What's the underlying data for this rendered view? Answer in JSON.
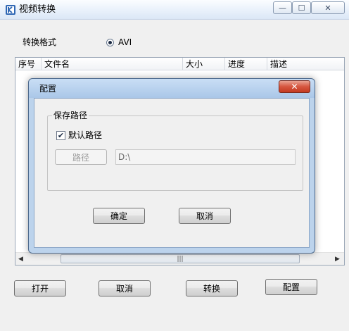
{
  "window": {
    "title": "视频转换",
    "controls": {
      "minimize": "—",
      "maximize": "☐",
      "close": "✕"
    }
  },
  "main": {
    "format_label": "转换格式",
    "format_option": "AVI",
    "columns": [
      "序号",
      "文件名",
      "大小",
      "进度",
      "描述"
    ],
    "buttons": {
      "open": "打开",
      "cancel": "取消",
      "convert": "转换",
      "config": "配置"
    }
  },
  "dialog": {
    "title": "配置",
    "close": "✕",
    "group_title": "保存路径",
    "default_path_label": "默认路径",
    "default_path_checked": true,
    "path_button": "路径",
    "path_value": "D:\\",
    "ok": "确定",
    "cancel": "取消"
  }
}
